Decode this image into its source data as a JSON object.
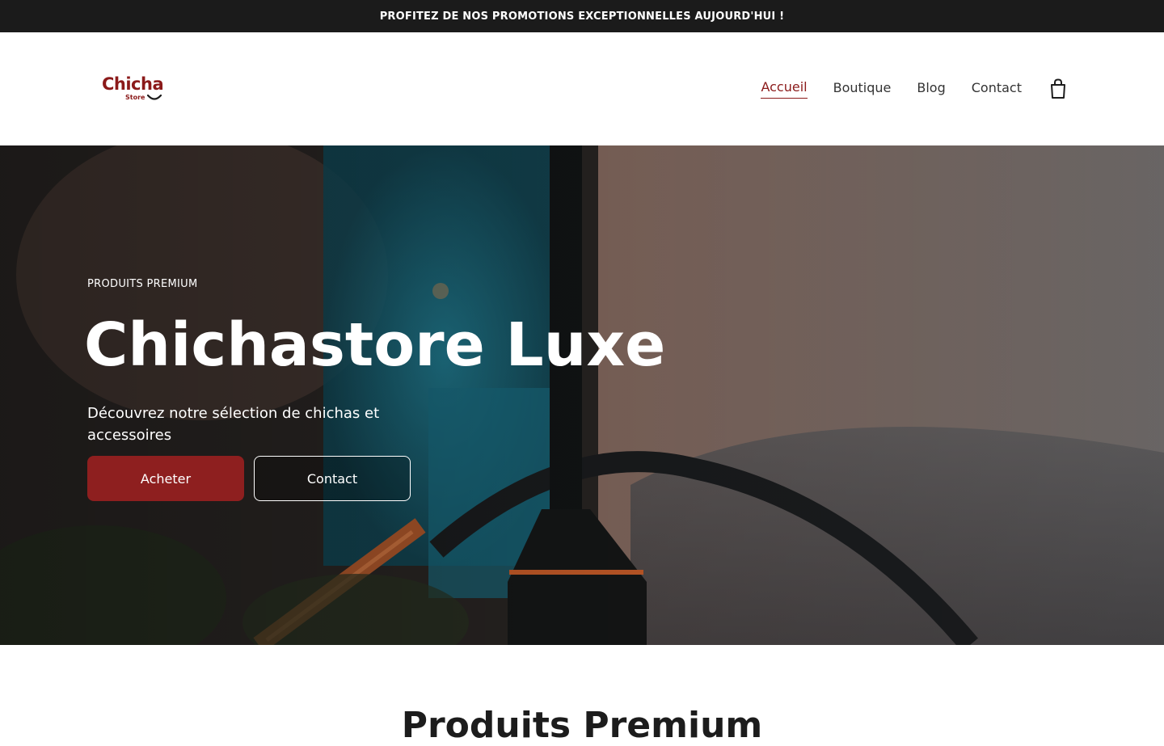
{
  "promo": {
    "text": "PROFITEZ DE NOS PROMOTIONS EXCEPTIONNELLES AUJOURD'HUI !"
  },
  "logo": {
    "word": "Chicha",
    "sub": "Store"
  },
  "nav": {
    "items": [
      {
        "label": "Accueil",
        "active": true
      },
      {
        "label": "Boutique"
      },
      {
        "label": "Blog"
      },
      {
        "label": "Contact"
      }
    ]
  },
  "hero": {
    "eyebrow": "PRODUITS PREMIUM",
    "title": "Chichastore Luxe",
    "subtitle": "Découvrez notre sélection de chichas et accessoires",
    "primary_button": "Acheter",
    "secondary_button": "Contact"
  },
  "next_section": {
    "title": "Produits Premium"
  },
  "colors": {
    "brand": "#8b1a1a",
    "topbar": "#1b1b1b",
    "button": "#8e1f1f"
  }
}
